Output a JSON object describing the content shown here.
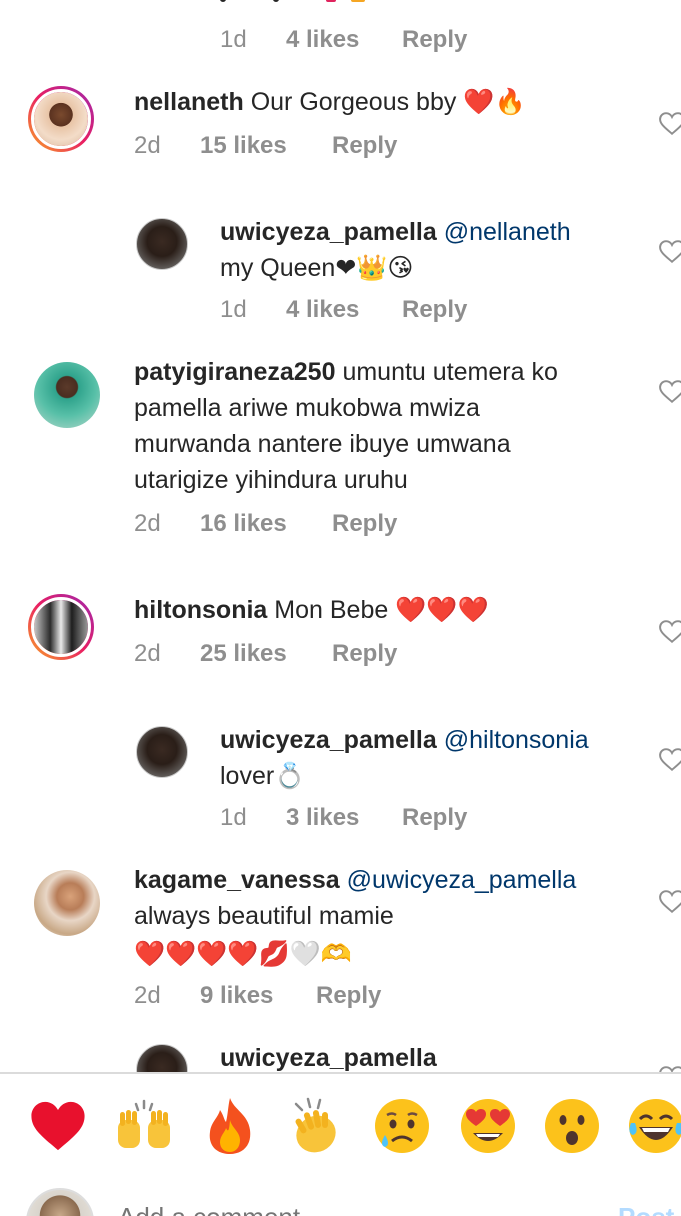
{
  "comments": [
    {
      "id": "c0",
      "partial": true,
      "time": "1d",
      "likes": "4 likes",
      "reply": "Reply"
    },
    {
      "id": "c1",
      "username": "nellaneth",
      "mention": "",
      "text": "Our Gorgeous bby",
      "emoji": "❤️🔥",
      "time": "2d",
      "likes": "15 likes",
      "reply": "Reply"
    },
    {
      "id": "c2",
      "username": "uwicyeza_pamella",
      "mention": "@nellaneth",
      "text": "my Queen",
      "emoji": "❤👑😘",
      "time": "1d",
      "likes": "4 likes",
      "reply": "Reply"
    },
    {
      "id": "c3",
      "username": "patyigiraneza250",
      "text_lines": [
        "umuntu utemera ko",
        "pamella ariwe mukobwa mwiza",
        "murwanda nantere ibuye umwana",
        "utarigize yihindura uruhu"
      ],
      "time": "2d",
      "likes": "16 likes",
      "reply": "Reply"
    },
    {
      "id": "c4",
      "username": "hiltonsonia",
      "text": "Mon Bebe",
      "emoji": "❤️❤️❤️",
      "time": "2d",
      "likes": "25 likes",
      "reply": "Reply"
    },
    {
      "id": "c5",
      "username": "uwicyeza_pamella",
      "mention": "@hiltonsonia",
      "text": "lover",
      "emoji": "💍",
      "time": "1d",
      "likes": "3 likes",
      "reply": "Reply"
    },
    {
      "id": "c6",
      "username": "kagame_vanessa",
      "mention": "@uwicyeza_pamella",
      "text": "always beautiful mamie",
      "emoji": "❤️❤️❤️❤️💋🤍🫶",
      "time": "2d",
      "likes": "9 likes",
      "reply": "Reply"
    },
    {
      "id": "c7",
      "username": "uwicyeza_pamella",
      "partial": true
    }
  ],
  "reactions": [
    {
      "name": "red-heart",
      "glyph": "❤️"
    },
    {
      "name": "raising-hands",
      "glyph": "🙌"
    },
    {
      "name": "fire",
      "glyph": "🔥"
    },
    {
      "name": "clapping-hands",
      "glyph": "👏"
    },
    {
      "name": "sad-face",
      "glyph": "😢"
    },
    {
      "name": "heart-eyes",
      "glyph": "😍"
    },
    {
      "name": "surprised-face",
      "glyph": "😮"
    },
    {
      "name": "laughing-tears",
      "glyph": "😂"
    }
  ],
  "composer": {
    "placeholder": "Add a comment...",
    "post_label": "Post"
  },
  "colors": {
    "username": "#262626",
    "mention": "#00376b",
    "meta": "#8e8e8e",
    "post": "#b3dbff"
  }
}
